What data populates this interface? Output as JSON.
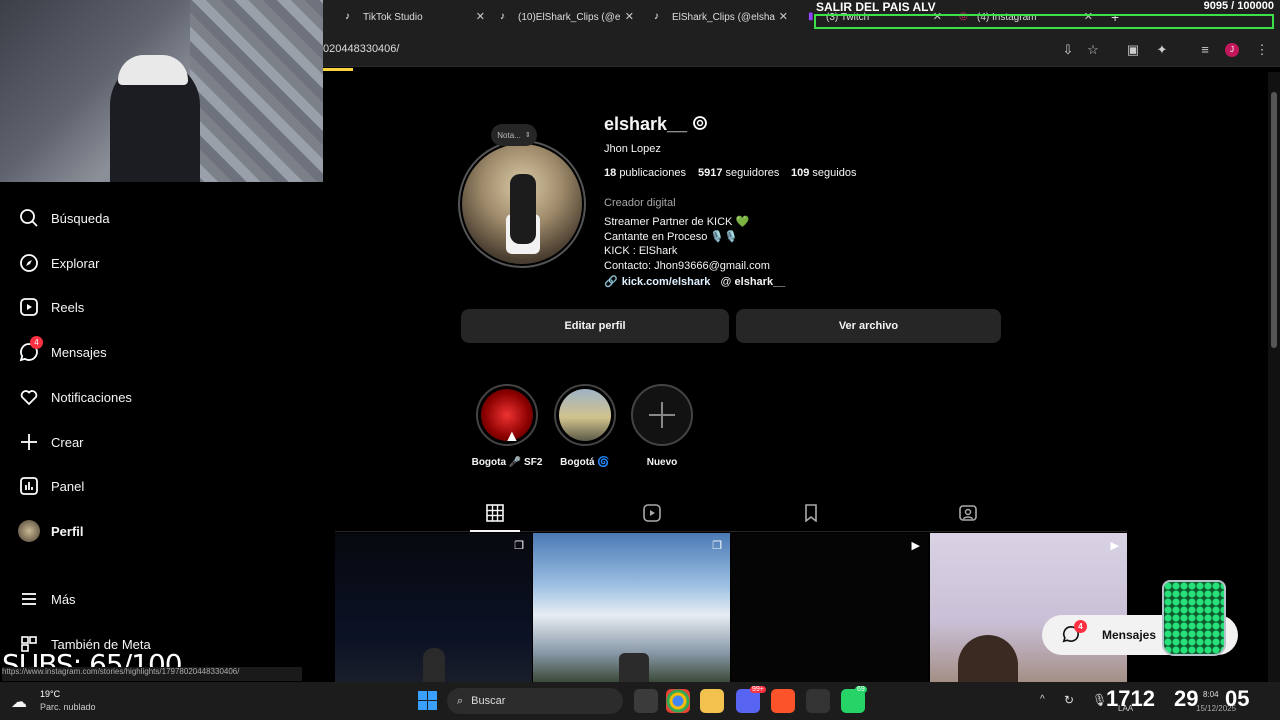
{
  "overlay": {
    "salir": "SALIR DEL PAIS ALV",
    "counter": "9095 / 100000",
    "subs": "SUBS: 65/100",
    "clock_big_1": "1712",
    "clock_big_2": "29",
    "clock_big_3": "05"
  },
  "browser": {
    "tabs": [
      {
        "label": "TikTok Studio"
      },
      {
        "label": "(10)ElShark_Clips (@e"
      },
      {
        "label": "ElShark_Clips (@elsha"
      },
      {
        "label": "(3) Twitch"
      },
      {
        "label": "(4) Instagram"
      }
    ],
    "url": "020448330406/",
    "status_url": "https://www.instagram.com/stories/highlights/17978020448330406/"
  },
  "sidebar": {
    "items": [
      {
        "label": "Búsqueda",
        "icon": "search-icon"
      },
      {
        "label": "Explorar",
        "icon": "compass-icon"
      },
      {
        "label": "Reels",
        "icon": "reels-icon"
      },
      {
        "label": "Mensajes",
        "icon": "messenger-icon",
        "badge": "4"
      },
      {
        "label": "Notificaciones",
        "icon": "heart-icon"
      },
      {
        "label": "Crear",
        "icon": "plus-icon"
      },
      {
        "label": "Panel",
        "icon": "dashboard-icon"
      },
      {
        "label": "Perfil",
        "icon": "avatar"
      }
    ],
    "more": "Más",
    "meta": "También de Meta"
  },
  "profile": {
    "note": "Nota...",
    "username": "elshark__",
    "full_name": "Jhon Lopez",
    "posts": "18",
    "posts_label": "publicaciones",
    "followers": "5917",
    "followers_label": "seguidores",
    "following": "109",
    "following_label": "seguidos",
    "category": "Creador digital",
    "bio": [
      "Streamer Partner de KICK 💚",
      "Cantante en Proceso 🎙️🎙️",
      "KICK : ElShark",
      "Contacto: Jhon93666@gmail.com"
    ],
    "link": "kick.com/elshark",
    "threads": "elshark__",
    "edit_button": "Editar perfil",
    "archive_button": "Ver archivo"
  },
  "highlights": [
    {
      "label": "Bogota 🎤 SF2"
    },
    {
      "label": "Bogotá 🌀"
    },
    {
      "label": "Nuevo"
    }
  ],
  "messages_pill": {
    "label": "Mensajes",
    "badge": "4"
  },
  "weather": {
    "temp": "19°C",
    "desc": "Parc. nublado"
  },
  "taskbar": {
    "search": "Buscar",
    "badge_discord": "99+",
    "badge_whatsapp": "69",
    "time": "8:04",
    "date": "15/12/2025",
    "lang": "LAA"
  },
  "colors": {
    "accent": "#0095f6",
    "badge": "#ff3040",
    "bg": "#000000",
    "button": "#262626"
  }
}
